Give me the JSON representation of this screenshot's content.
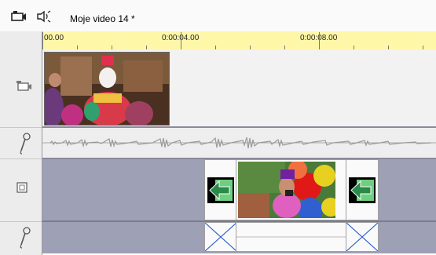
{
  "title": "Moje video 14 *",
  "ruler": {
    "labels": [
      "00.00",
      "0:00:04.00",
      "0:00:08.00"
    ]
  },
  "tracks": [
    {
      "name": "video-track",
      "icon": "camcorder-icon"
    },
    {
      "name": "audio-track",
      "icon": "microphone-icon"
    },
    {
      "name": "overlay-track",
      "icon": "overlay-icon"
    },
    {
      "name": "overlay-audio-track",
      "icon": "microphone-icon"
    }
  ],
  "toolbar_icons": [
    "camcorder-icon",
    "speaker-icon"
  ],
  "colors": {
    "ruler": "#fff7a8",
    "overlay_track": "#9ea0b6",
    "transition_arrow": "#7fd08f"
  }
}
